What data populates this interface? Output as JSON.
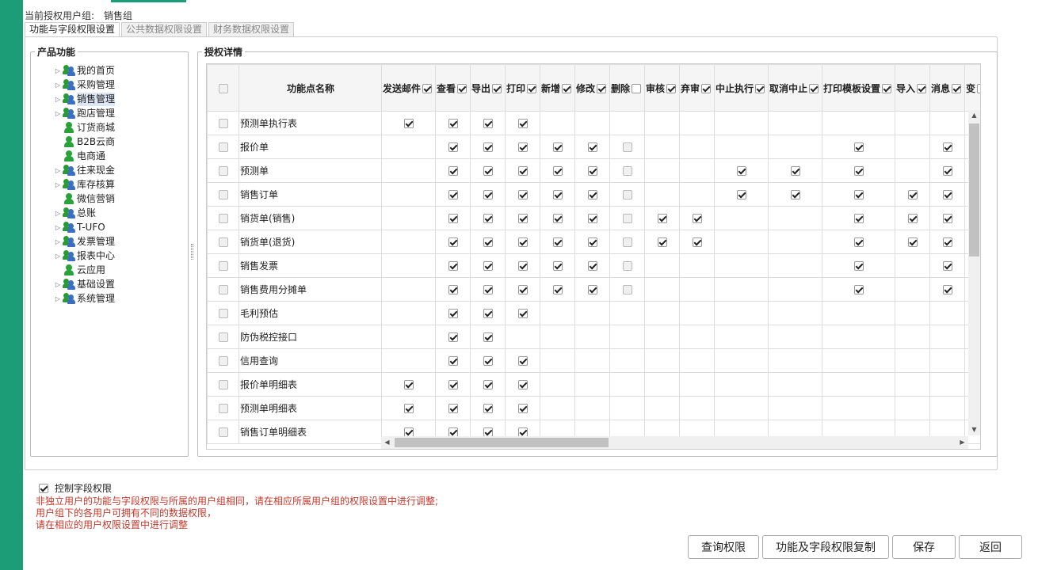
{
  "header": {
    "group_label": "当前授权用户组:",
    "group_value": "销售组"
  },
  "tabs": [
    {
      "label": "功能与字段权限设置",
      "active": true
    },
    {
      "label": "公共数据权限设置"
    },
    {
      "label": "财务数据权限设置"
    }
  ],
  "left_panel": {
    "title": "产品功能",
    "tree": [
      {
        "label": "我的首页",
        "icon": "group-icon",
        "expandable": true
      },
      {
        "label": "采购管理",
        "icon": "group-icon",
        "expandable": true
      },
      {
        "label": "销售管理",
        "icon": "group-icon",
        "expandable": true,
        "selected": true
      },
      {
        "label": "跑店管理",
        "icon": "group-icon",
        "expandable": true
      },
      {
        "label": "订货商城",
        "icon": "user-icon",
        "expandable": false
      },
      {
        "label": "B2B云商",
        "icon": "user-icon",
        "expandable": false
      },
      {
        "label": "电商通",
        "icon": "user-icon",
        "expandable": false
      },
      {
        "label": "往来现金",
        "icon": "group-icon",
        "expandable": true
      },
      {
        "label": "库存核算",
        "icon": "group-icon",
        "expandable": true
      },
      {
        "label": "微信营销",
        "icon": "user-icon",
        "expandable": false
      },
      {
        "label": "总账",
        "icon": "group-icon",
        "expandable": true
      },
      {
        "label": "T-UFO",
        "icon": "group-icon",
        "expandable": true
      },
      {
        "label": "发票管理",
        "icon": "group-icon",
        "expandable": true
      },
      {
        "label": "报表中心",
        "icon": "group-icon",
        "expandable": true
      },
      {
        "label": "云应用",
        "icon": "user-icon",
        "expandable": false
      },
      {
        "label": "基础设置",
        "icon": "group-icon",
        "expandable": true
      },
      {
        "label": "系统管理",
        "icon": "group-icon",
        "expandable": true
      }
    ]
  },
  "right_panel": {
    "title": "授权详情"
  },
  "grid": {
    "name_header": "功能点名称",
    "columns": [
      {
        "label": "发送邮件",
        "checked": true
      },
      {
        "label": "查看",
        "checked": true
      },
      {
        "label": "导出",
        "checked": true
      },
      {
        "label": "打印",
        "checked": true
      },
      {
        "label": "新增",
        "checked": true
      },
      {
        "label": "修改",
        "checked": true
      },
      {
        "label": "删除",
        "checked": false
      },
      {
        "label": "审核",
        "checked": true
      },
      {
        "label": "弃审",
        "checked": true
      },
      {
        "label": "中止执行",
        "checked": true
      },
      {
        "label": "取消中止",
        "checked": true
      },
      {
        "label": "打印模板设置",
        "checked": true
      },
      {
        "label": "导入",
        "checked": true
      },
      {
        "label": "消息",
        "checked": true
      },
      {
        "label": "变",
        "checked": false
      }
    ],
    "rows": [
      {
        "name": "预测单执行表",
        "cells": [
          1,
          1,
          1,
          1,
          null,
          null,
          null,
          null,
          null,
          null,
          null,
          null,
          null,
          null
        ]
      },
      {
        "name": "报价单",
        "cells": [
          null,
          1,
          1,
          1,
          1,
          1,
          0,
          null,
          null,
          null,
          null,
          1,
          null,
          1
        ]
      },
      {
        "name": "预测单",
        "cells": [
          null,
          1,
          1,
          1,
          1,
          1,
          0,
          null,
          null,
          1,
          1,
          1,
          null,
          1
        ]
      },
      {
        "name": "销售订单",
        "cells": [
          null,
          1,
          1,
          1,
          1,
          1,
          0,
          null,
          null,
          1,
          1,
          1,
          1,
          1
        ]
      },
      {
        "name": "销货单(销售)",
        "cells": [
          null,
          1,
          1,
          1,
          1,
          1,
          0,
          1,
          1,
          null,
          null,
          1,
          1,
          1
        ]
      },
      {
        "name": "销货单(退货)",
        "cells": [
          null,
          1,
          1,
          1,
          1,
          1,
          0,
          1,
          1,
          null,
          null,
          1,
          1,
          1
        ]
      },
      {
        "name": "销售发票",
        "cells": [
          null,
          1,
          1,
          1,
          1,
          1,
          0,
          null,
          null,
          null,
          null,
          1,
          null,
          1
        ]
      },
      {
        "name": "销售费用分摊单",
        "cells": [
          null,
          1,
          1,
          1,
          1,
          1,
          0,
          null,
          null,
          null,
          null,
          1,
          null,
          1
        ]
      },
      {
        "name": "毛利预估",
        "cells": [
          null,
          1,
          1,
          1,
          null,
          null,
          null,
          null,
          null,
          null,
          null,
          null,
          null,
          null
        ]
      },
      {
        "name": "防伪税控接口",
        "cells": [
          null,
          1,
          1,
          null,
          null,
          null,
          null,
          null,
          null,
          null,
          null,
          null,
          null,
          null
        ]
      },
      {
        "name": "信用查询",
        "cells": [
          null,
          1,
          1,
          1,
          null,
          null,
          null,
          null,
          null,
          null,
          null,
          null,
          null,
          null
        ]
      },
      {
        "name": "报价单明细表",
        "cells": [
          1,
          1,
          1,
          1,
          null,
          null,
          null,
          null,
          null,
          null,
          null,
          null,
          null,
          null
        ]
      },
      {
        "name": "预测单明细表",
        "cells": [
          1,
          1,
          1,
          1,
          null,
          null,
          null,
          null,
          null,
          null,
          null,
          null,
          null,
          null
        ]
      },
      {
        "name": "销售订单明细表",
        "cells": [
          1,
          1,
          1,
          1,
          null,
          null,
          null,
          null,
          null,
          null,
          null,
          null,
          null,
          null
        ]
      }
    ]
  },
  "footer": {
    "control_label": "控制字段权限",
    "control_checked": true,
    "notes": [
      "非独立用户的功能与字段权限与所属的用户组相同，请在相应所属用户组的权限设置中进行调整;",
      "用户组下的各用户可拥有不同的数据权限，",
      "请在相应的用户权限设置中进行调整"
    ]
  },
  "buttons": {
    "query": "查询权限",
    "copy": "功能及字段权限复制",
    "save": "保存",
    "back": "返回"
  },
  "colors": {
    "accent": "#1d9c78",
    "note": "#c0392b"
  }
}
